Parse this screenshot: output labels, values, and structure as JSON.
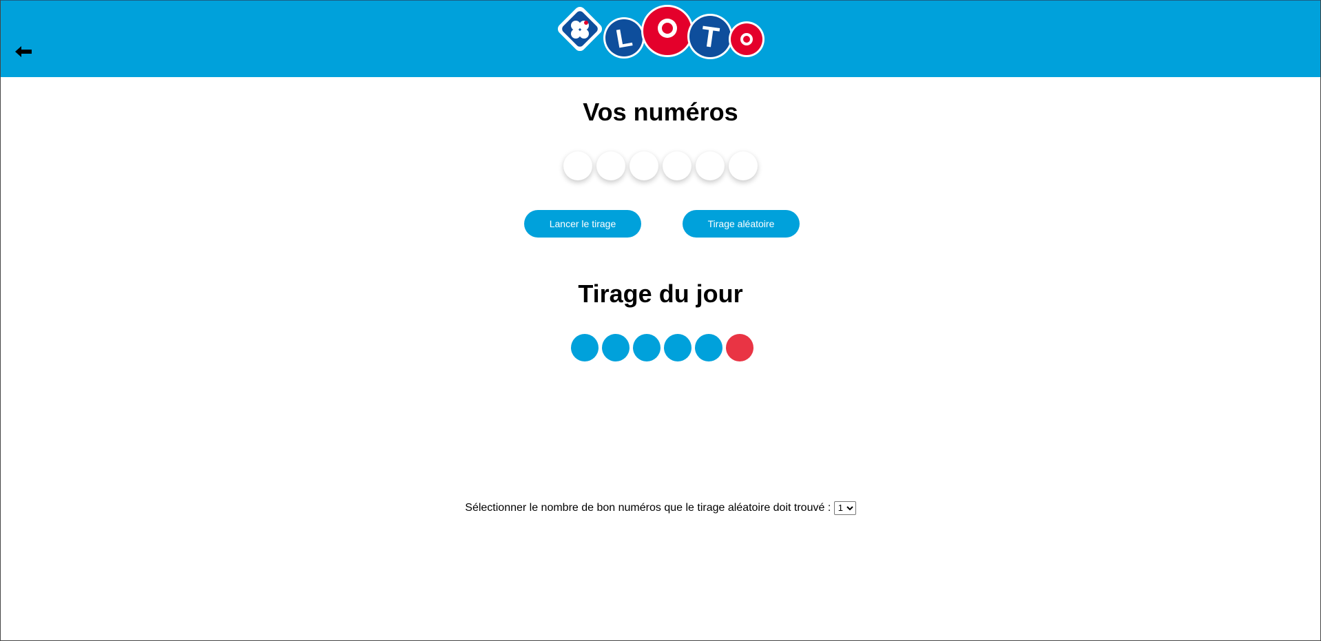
{
  "header": {
    "background_color": "#00a1db",
    "back_icon": "arrow-left-icon",
    "logo": {
      "text": "LOTO",
      "letters": [
        "L",
        "O",
        "T",
        "O"
      ],
      "clover_icon": "clover-icon"
    }
  },
  "user_section": {
    "title": "Vos numéros",
    "balls": [
      "",
      "",
      "",
      "",
      "",
      ""
    ]
  },
  "buttons": {
    "lancer_label": "Lancer le tirage",
    "aleatoire_label": "Tirage aléatoire",
    "color": "#00a1db"
  },
  "draw_section": {
    "title": "Tirage du jour",
    "balls": [
      {
        "number": "",
        "color": "#00a1db"
      },
      {
        "number": "",
        "color": "#00a1db"
      },
      {
        "number": "",
        "color": "#00a1db"
      },
      {
        "number": "",
        "color": "#00a1db"
      },
      {
        "number": "",
        "color": "#00a1db"
      },
      {
        "number": "",
        "color": "#e93444"
      }
    ]
  },
  "selector": {
    "label": "Sélectionner le nombre de bon numéros que le tirage aléatoire doit trouvé :",
    "selected_value": "1"
  }
}
